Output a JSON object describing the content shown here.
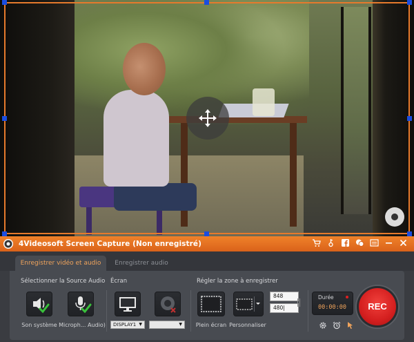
{
  "app": {
    "title": "4Videosoft Screen Capture (Non enregistré)"
  },
  "colors": {
    "accent": "#e67a2c",
    "titlebar": "#d9621a",
    "active_tab_text": "#f0a45c",
    "rec_red": "#d41f1f",
    "handle_blue": "#1a4de0",
    "check_green": "#39c23b"
  },
  "titlebar_icons": [
    "cart-icon",
    "key-icon",
    "facebook-icon",
    "chat-icon",
    "menu-icon",
    "minimize-icon",
    "close-icon"
  ],
  "tabs": [
    {
      "label": "Enregistrer vidéo et audio",
      "active": true
    },
    {
      "label": "Enregistrer audio",
      "active": false
    }
  ],
  "sections": {
    "audio_source": "Sélectionner la Source Audio",
    "screen": "Écran",
    "zone": "Régler la zone à enregistrer"
  },
  "audio": {
    "system_label": "Son système",
    "mic_label": "Microph... Audio)"
  },
  "screen": {
    "display_value": "DISPLAY1",
    "second_value": ""
  },
  "zone": {
    "fullscreen_label": "Plein écran",
    "custom_label": "Personnaliser",
    "width": "848",
    "height": "480|"
  },
  "duration": {
    "label": "Durée",
    "value": "00:00:00"
  },
  "rec": {
    "label": "REC"
  }
}
